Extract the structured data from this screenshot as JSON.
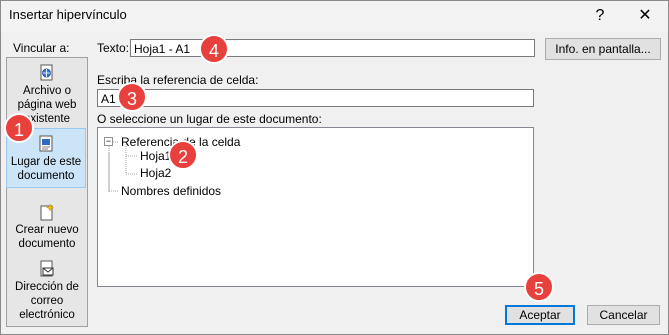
{
  "window": {
    "title": "Insertar hipervínculo",
    "help_glyph": "?",
    "close_glyph": "✕"
  },
  "link_to": {
    "label": "Vincular a:",
    "items": [
      {
        "label_lines": [
          "Archivo o",
          "página web",
          "existente"
        ],
        "icon": "globe-file-icon"
      },
      {
        "label_lines": [
          "Lugar de este",
          "documento"
        ],
        "icon": "document-place-icon"
      },
      {
        "label_lines": [
          "Crear nuevo",
          "documento"
        ],
        "icon": "new-document-icon"
      },
      {
        "label_lines": [
          "Dirección de",
          "correo",
          "electrónico"
        ],
        "icon": "email-icon"
      }
    ]
  },
  "text_field": {
    "label": "Texto:",
    "value": "Hoja1 - A1"
  },
  "screentip_button": "Info. en pantalla...",
  "cell_ref": {
    "label": "Escriba la referencia de celda:",
    "value": "A1"
  },
  "tree": {
    "label": "O seleccione un lugar de este documento:",
    "expand_glyph": "−",
    "root": "Referencia de la celda",
    "sheets": [
      "Hoja1",
      "Hoja2"
    ],
    "names": "Nombres definidos"
  },
  "buttons": {
    "ok": "Aceptar",
    "cancel": "Cancelar"
  },
  "badges": [
    "1",
    "2",
    "3",
    "4",
    "5"
  ],
  "colors": {
    "badge": "#e8403d",
    "selection": "#cce4f7",
    "default_button_border": "#0078d7"
  }
}
